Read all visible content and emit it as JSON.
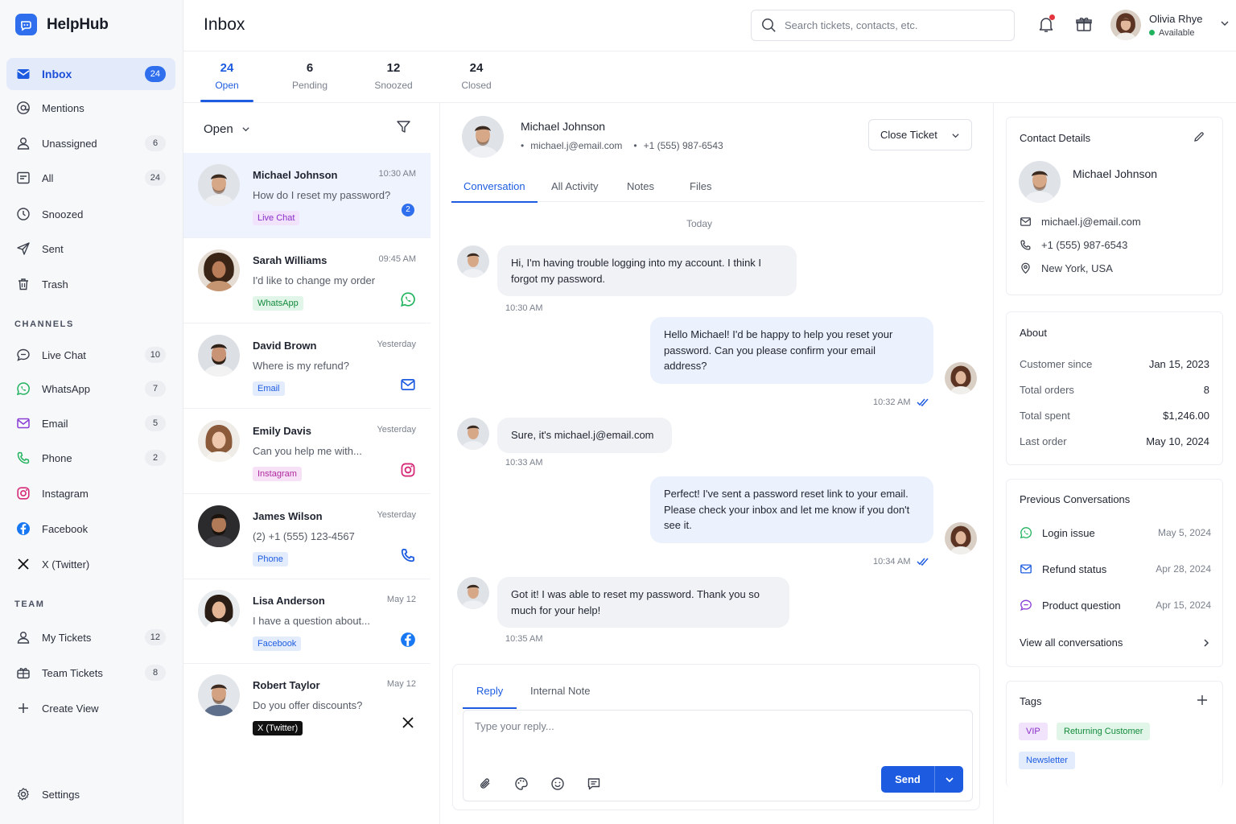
{
  "app": {
    "name": "HelpHub"
  },
  "header": {
    "title": "Inbox",
    "search_placeholder": "Search tickets, contacts, etc.",
    "user": {
      "name": "Olivia Rhye",
      "status": "Available"
    }
  },
  "sidebar": {
    "items": [
      {
        "label": "Inbox",
        "count": "24"
      },
      {
        "label": "Mentions",
        "count": ""
      },
      {
        "label": "Unassigned",
        "count": "6"
      },
      {
        "label": "All",
        "count": "24"
      },
      {
        "label": "Snoozed",
        "count": ""
      },
      {
        "label": "Sent",
        "count": ""
      },
      {
        "label": "Trash",
        "count": ""
      }
    ],
    "channels_title": "CHANNELS",
    "channels": [
      {
        "label": "Live Chat",
        "count": "10"
      },
      {
        "label": "WhatsApp",
        "count": "7"
      },
      {
        "label": "Email",
        "count": "5"
      },
      {
        "label": "Phone",
        "count": "2"
      },
      {
        "label": "Instagram",
        "count": ""
      },
      {
        "label": "Facebook",
        "count": ""
      },
      {
        "label": "X (Twitter)",
        "count": ""
      }
    ],
    "team_title": "TEAM",
    "team": [
      {
        "label": "My Tickets",
        "count": "12"
      },
      {
        "label": "Team Tickets",
        "count": "8"
      },
      {
        "label": "Create View",
        "count": ""
      }
    ],
    "settings": "Settings"
  },
  "status_tabs": [
    {
      "count": "24",
      "label": "Open"
    },
    {
      "count": "6",
      "label": "Pending"
    },
    {
      "count": "12",
      "label": "Snoozed"
    },
    {
      "count": "24",
      "label": "Closed"
    }
  ],
  "list": {
    "filter": "Open",
    "tickets": [
      {
        "name": "Michael Johnson",
        "time": "10:30 AM",
        "message": "How do I reset my password?",
        "tag": "Live Chat",
        "unread": "2"
      },
      {
        "name": "Sarah Williams",
        "time": "09:45 AM",
        "message": "I'd like to change my order",
        "tag": "WhatsApp"
      },
      {
        "name": "David Brown",
        "time": "Yesterday",
        "message": "Where is my refund?",
        "tag": "Email"
      },
      {
        "name": "Emily Davis",
        "time": "Yesterday",
        "message": "Can you help me with...",
        "tag": "Instagram"
      },
      {
        "name": "James Wilson",
        "time": "Yesterday",
        "message": "(2)    +1 (555) 123-4567",
        "tag": "Phone"
      },
      {
        "name": "Lisa Anderson",
        "time": "May 12",
        "message": "I have a question about...",
        "tag": "Facebook"
      },
      {
        "name": "Robert Taylor",
        "time": "May 12",
        "message": "Do you offer discounts?",
        "tag": "X (Twitter)"
      }
    ]
  },
  "conversation": {
    "contact_name": "Michael Johnson",
    "email": "michael.j@email.com",
    "phone": "+1 (555) 987-6543",
    "close_label": "Close Ticket",
    "tabs": [
      "Conversation",
      "All Activity",
      "Notes",
      "Files"
    ],
    "day_label": "Today",
    "messages": [
      {
        "text": "Hi, I'm having trouble logging into my account. I think I forgot my password.",
        "time": "10:30 AM"
      },
      {
        "text": "Hello Michael! I'd be happy to help you reset your password. Can you please confirm your email address?",
        "time": "10:32 AM"
      },
      {
        "text": "Sure, it's michael.j@email.com",
        "time": "10:33 AM"
      },
      {
        "text": "Perfect! I've sent a password reset link to your email. Please check your inbox and let me know if you don't see it.",
        "time": "10:34 AM"
      },
      {
        "text": "Got it! I was able to reset my password. Thank you so much for your help!",
        "time": "10:35 AM"
      }
    ],
    "reply": {
      "tabs": [
        "Reply",
        "Internal Note"
      ],
      "placeholder": "Type your reply...",
      "send_label": "Send"
    }
  },
  "contact": {
    "title": "Contact Details",
    "name": "Michael Johnson",
    "email": "michael.j@email.com",
    "phone": "+1 (555) 987-6543",
    "location": "New York, USA",
    "about_title": "About",
    "about": [
      {
        "key": "Customer since",
        "value": "Jan 15, 2023"
      },
      {
        "key": "Total orders",
        "value": "8"
      },
      {
        "key": "Total spent",
        "value": "$1,246.00"
      },
      {
        "key": "Last order",
        "value": "May 10, 2024"
      }
    ],
    "previous_title": "Previous Conversations",
    "previous": [
      {
        "subject": "Login issue",
        "date": "May 5, 2024"
      },
      {
        "subject": "Refund status",
        "date": "Apr 28, 2024"
      },
      {
        "subject": "Product question",
        "date": "Apr 15, 2024"
      }
    ],
    "view_all": "View all conversations",
    "tags_title": "Tags",
    "tags": [
      "VIP",
      "Returning Customer",
      "Newsletter"
    ]
  },
  "colors": {
    "accent": "#1d5ce0",
    "whatsapp": "#22b35f",
    "instagram": "#d62976",
    "facebook": "#1877f2"
  }
}
